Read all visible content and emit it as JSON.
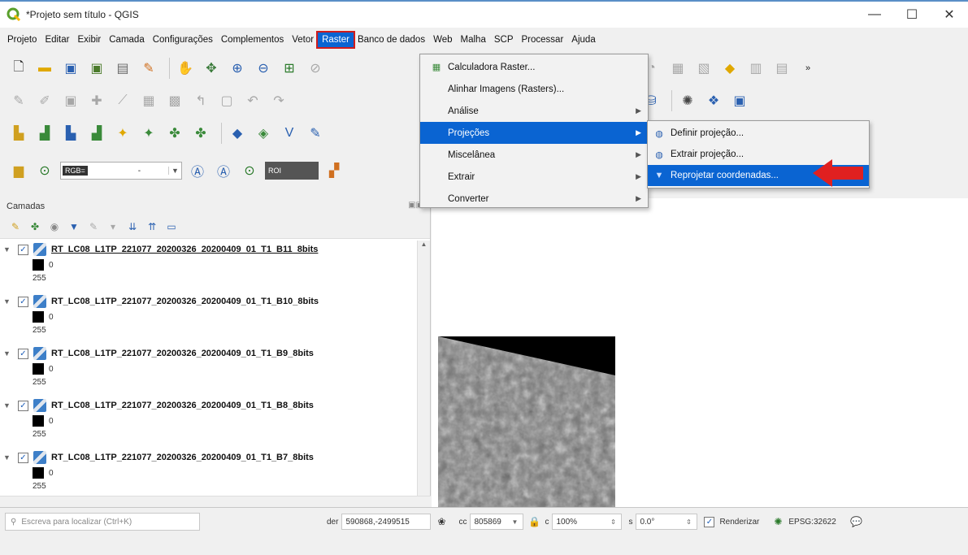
{
  "window": {
    "title": "*Projeto sem título - QGIS",
    "minimize": "—",
    "maximize": "☐",
    "close": "✕"
  },
  "menubar": [
    "Projeto",
    "Editar",
    "Exibir",
    "Camada",
    "Configurações",
    "Complementos",
    "Vetor",
    "Raster",
    "Banco de dados",
    "Web",
    "Malha",
    "SCP",
    "Processar",
    "Ajuda"
  ],
  "raster_menu": {
    "items": [
      {
        "label": "Calculadora Raster...",
        "has_icon": true,
        "submenu": false
      },
      {
        "label": "Alinhar Imagens (Rasters)...",
        "has_icon": false,
        "submenu": false
      },
      {
        "label": "Análise",
        "has_icon": false,
        "submenu": true
      },
      {
        "label": "Projeções",
        "has_icon": false,
        "submenu": true
      },
      {
        "label": "Miscelânea",
        "has_icon": false,
        "submenu": true
      },
      {
        "label": "Extrair",
        "has_icon": false,
        "submenu": true
      },
      {
        "label": "Converter",
        "has_icon": false,
        "submenu": true
      }
    ]
  },
  "projections_submenu": {
    "items": [
      {
        "label": "Definir projeção..."
      },
      {
        "label": "Extrair projeção..."
      },
      {
        "label": "Reprojetar coordenadas..."
      }
    ]
  },
  "toolbar": {
    "rgb_tag": "RGB=",
    "rgb_value": "-",
    "roi_tag": "ROI"
  },
  "layers_panel": {
    "title": "Camadas",
    "layers": [
      {
        "name": "RT_LC08_L1TP_221077_20200326_20200409_01_T1_B11_8bits",
        "min": "0",
        "max": "255"
      },
      {
        "name": "RT_LC08_L1TP_221077_20200326_20200409_01_T1_B10_8bits",
        "min": "0",
        "max": "255"
      },
      {
        "name": "RT_LC08_L1TP_221077_20200326_20200409_01_T1_B9_8bits",
        "min": "0",
        "max": "255"
      },
      {
        "name": "RT_LC08_L1TP_221077_20200326_20200409_01_T1_B8_8bits",
        "min": "0",
        "max": "255"
      },
      {
        "name": "RT_LC08_L1TP_221077_20200326_20200409_01_T1_B7_8bits",
        "min": "0",
        "max": "255"
      }
    ]
  },
  "statusbar": {
    "locator_placeholder": "Escreva para localizar (Ctrl+K)",
    "coord_label": "der",
    "coord_value": "590868,-2499515",
    "scale_label": "cc",
    "scale_value": "805869",
    "magnifier_label": "c",
    "magnifier_value": "100%",
    "rotation_label": "s",
    "rotation_value": "0.0°",
    "render_label": "Renderizar",
    "crs": "EPSG:32622"
  },
  "colors": {
    "highlight": "#0a64d2",
    "red_outline": "#d01c1c",
    "arrow_red": "#e02020"
  }
}
